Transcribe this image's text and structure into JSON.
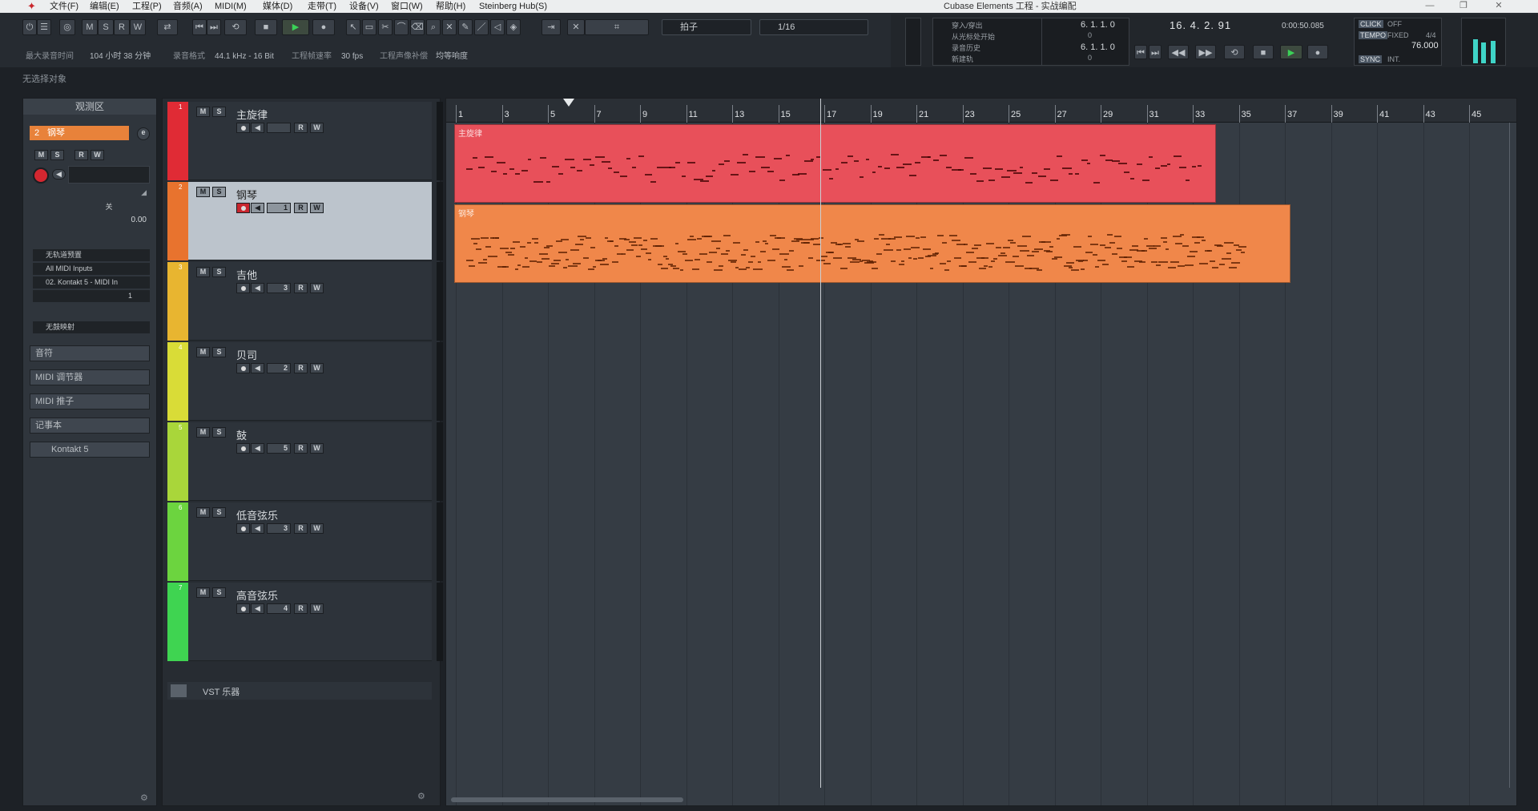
{
  "app": {
    "window_title": "Cubase Elements 工程 - 实战编配",
    "menus": [
      "文件(F)",
      "编辑(E)",
      "工程(P)",
      "音频(A)",
      "MIDI(M)",
      "媒体(D)",
      "走带(T)",
      "设备(V)",
      "窗口(W)",
      "帮助(H)",
      "Steinberg Hub(S)"
    ]
  },
  "toolbar": {
    "mode_buttons": [
      "M",
      "S",
      "R",
      "W"
    ],
    "grid_type": "拍子",
    "quantize": "1/16",
    "info": [
      {
        "label": "最大录音时间",
        "value": "104 小时 38 分钟"
      },
      {
        "label": "录音格式",
        "value": "44.1 kHz - 16 Bit"
      },
      {
        "label": "工程帧速率",
        "value": "30 fps"
      },
      {
        "label": "工程声像补偿",
        "value": "均等响度"
      }
    ]
  },
  "transport": {
    "items": [
      "穿入/穿出",
      "从光标处开始",
      "录音历史",
      "新建轨"
    ],
    "left_locator": "6. 1. 1. 0",
    "right_locator": "6. 1. 1. 0",
    "locator_zero_1": "0",
    "locator_zero_2": "0",
    "position_bars": "16. 4. 2. 91",
    "position_time": "0:00:50.085",
    "click_label": "CLICK",
    "click_value": "OFF",
    "tempo_label": "TEMPO",
    "tempo_mode": "FIXED",
    "signature": "4/4",
    "tempo_value": "76.000",
    "sync_label": "SYNC",
    "sync_value": "INT."
  },
  "status": {
    "selection": "无选择对象"
  },
  "inspector": {
    "title": "观测区",
    "track_number": "2",
    "track_name": "钢琴",
    "volume_value": "0.00",
    "pan_value": "关",
    "routing": [
      "无轨道预置",
      "All MIDI Inputs",
      "02. Kontakt 5 - MIDI In"
    ],
    "channel": "1",
    "drum_map": "无鼓映射",
    "sections": [
      "音符",
      "MIDI 调节器",
      "MIDI 推子",
      "记事本",
      "Kontakt 5"
    ]
  },
  "tracks": [
    {
      "number": "1",
      "name": "主旋律",
      "color": "#e02b35",
      "channel": "",
      "part_label": "主旋律"
    },
    {
      "number": "2",
      "name": "钢琴",
      "color": "#e8732e",
      "channel": "1",
      "part_label": "钢琴"
    },
    {
      "number": "3",
      "name": "吉他",
      "color": "#e8b530",
      "channel": "3"
    },
    {
      "number": "4",
      "name": "贝司",
      "color": "#d9dc37",
      "channel": "2"
    },
    {
      "number": "5",
      "name": "鼓",
      "color": "#a9d63a",
      "channel": "5"
    },
    {
      "number": "6",
      "name": "低音弦乐",
      "color": "#6cd43f",
      "channel": "3"
    },
    {
      "number": "7",
      "name": "高音弦乐",
      "color": "#3fd451",
      "channel": "4"
    }
  ],
  "folder_label": "VST 乐器",
  "ruler": {
    "bars": [
      "1",
      "3",
      "5",
      "7",
      "9",
      "11",
      "13",
      "15",
      "17",
      "19",
      "21",
      "23",
      "25",
      "27",
      "29",
      "31",
      "33",
      "35",
      "37",
      "39",
      "41",
      "43",
      "45"
    ]
  },
  "colors": {
    "melody_part": "#e8505a",
    "piano_part": "#f0874a"
  }
}
